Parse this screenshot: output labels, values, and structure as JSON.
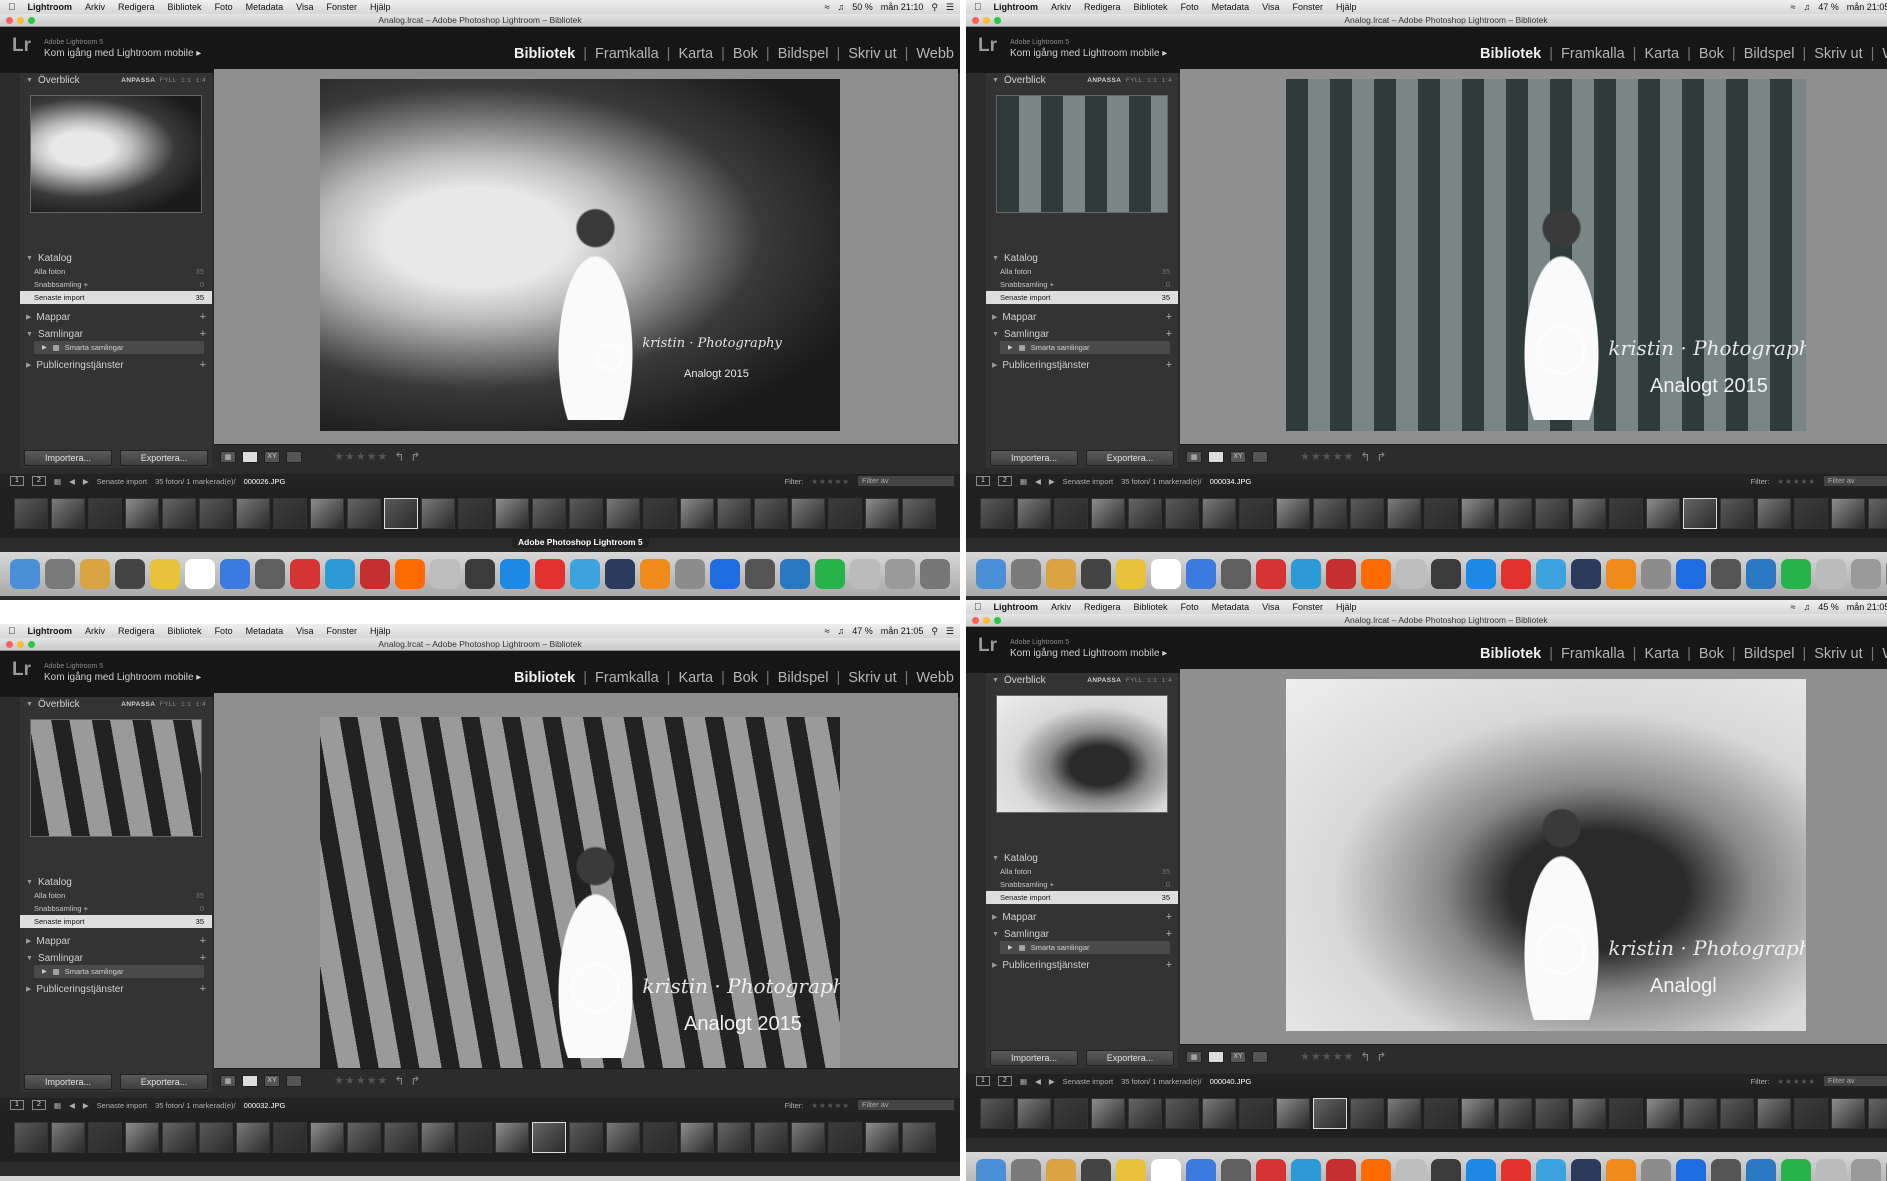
{
  "menubar": {
    "app_name": "Lightroom",
    "items": [
      "Arkiv",
      "Redigera",
      "Bibliotek",
      "Foto",
      "Metadata",
      "Visa",
      "Fonster",
      "Hjälp"
    ]
  },
  "quadrants": [
    {
      "clock": "mån 21:10",
      "battery": "50 %",
      "file": "000026.JPG",
      "dock_tooltip": "Adobe Photoshop Lightroom 5",
      "watermark_year": "Analogt 2015"
    },
    {
      "clock": "mån 21:05",
      "battery": "47 %",
      "file": "000034.JPG",
      "dock_tooltip": "",
      "watermark_year": "Analogt 2015"
    },
    {
      "clock": "mån 21:05",
      "battery": "47 %",
      "file": "000032.JPG",
      "dock_tooltip": "",
      "watermark_year": "Analogt 2015"
    },
    {
      "clock": "mån 21:05",
      "battery": "45 %",
      "file": "000040.JPG",
      "dock_tooltip": "",
      "watermark_year": "Analogl"
    }
  ],
  "window": {
    "title": "Analog.lrcat – Adobe Photoshop Lightroom – Bibliotek"
  },
  "identity": {
    "logo": "Lr",
    "version": "Adobe Lightroom 5",
    "mobile": "Kom igång med Lightroom mobile ▸"
  },
  "modules": [
    "Bibliotek",
    "Framkalla",
    "Karta",
    "Bok",
    "Bildspel",
    "Skriv ut",
    "Webb"
  ],
  "navigator": {
    "title": "Överblick",
    "options": [
      "ANPASSA",
      "FYLL",
      "1:1",
      "1:4"
    ]
  },
  "catalog": {
    "title": "Katalog",
    "rows": [
      {
        "label": "Alla foton",
        "count": "35"
      },
      {
        "label": "Snabbsamling +",
        "count": "0"
      },
      {
        "label": "Senaste import",
        "count": "35"
      }
    ]
  },
  "panels": {
    "folders": "Mappar",
    "collections": "Samlingar",
    "smart_collections": "Smarta samlingar",
    "publish": "Publiceringstjänster"
  },
  "buttons": {
    "import": "Importera...",
    "export": "Exportera..."
  },
  "filmstrip": {
    "source": "Senaste import",
    "info": "35 foton/ 1 markerad(e)/",
    "filter_label": "Filter:",
    "filter_value": "Filter av"
  },
  "watermark": {
    "script": "kristin · Photography"
  },
  "colors": {
    "accent": "#f2f2f2",
    "panel": "#333333",
    "viewer_bg": "#8f8f8f"
  }
}
